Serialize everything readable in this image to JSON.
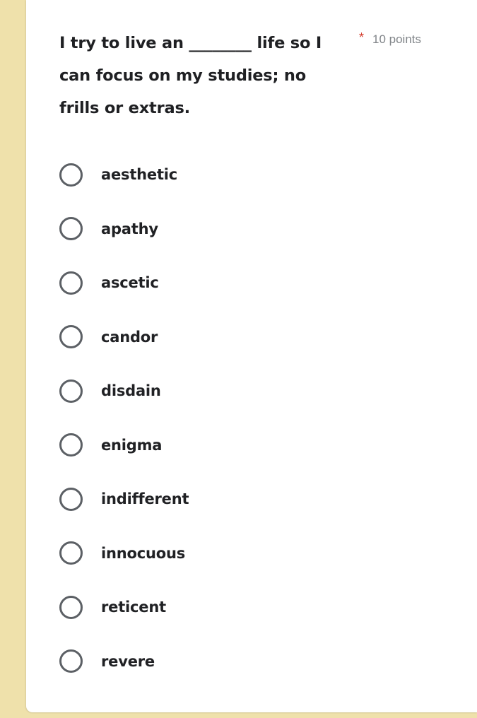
{
  "page": {
    "gutter_color": "#efe1ab",
    "card_color": "#ffffff"
  },
  "question": {
    "text": "I try to live an ________ life so I can focus on my studies; no frills or extras.",
    "required_marker": "*",
    "required_marker_color": "#d33b2c",
    "points_label": "10 points",
    "points_color": "#818589"
  },
  "options": [
    {
      "label": "aesthetic",
      "selected": false
    },
    {
      "label": "apathy",
      "selected": false
    },
    {
      "label": "ascetic",
      "selected": false
    },
    {
      "label": "candor",
      "selected": false
    },
    {
      "label": "disdain",
      "selected": false
    },
    {
      "label": "enigma",
      "selected": false
    },
    {
      "label": "indifferent",
      "selected": false
    },
    {
      "label": "innocuous",
      "selected": false
    },
    {
      "label": "reticent",
      "selected": false
    },
    {
      "label": "revere",
      "selected": false
    }
  ]
}
